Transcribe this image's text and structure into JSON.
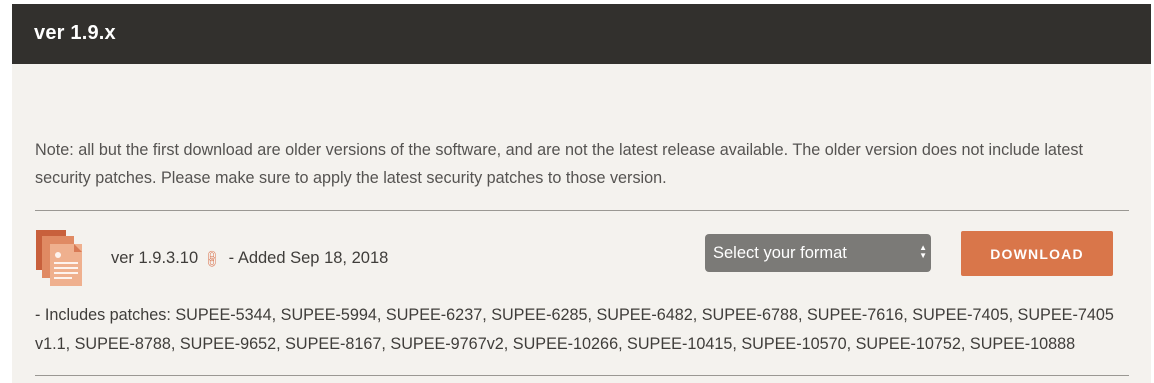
{
  "header": {
    "title": "ver 1.9.x"
  },
  "note": {
    "text": "Note: all but the first download are older versions of the software, and are not the latest release available. The older version does not include latest security patches. Please make sure to apply the latest security patches to those version."
  },
  "release": {
    "version": "ver 1.9.3.10",
    "added": "- Added Sep 18, 2018",
    "icon": "document-stack-icon",
    "link_icon": "link-icon",
    "format_select": {
      "selected": "Select your format"
    },
    "download_label": "DOWNLOAD",
    "patches": "- Includes patches: SUPEE-5344, SUPEE-5994, SUPEE-6237, SUPEE-6285, SUPEE-6482, SUPEE-6788, SUPEE-7616, SUPEE-7405, SUPEE-7405 v1.1, SUPEE-8788, SUPEE-9652, SUPEE-8167, SUPEE-9767v2, SUPEE-10266, SUPEE-10415, SUPEE-10570, SUPEE-10752, SUPEE-10888"
  },
  "colors": {
    "header_bg": "#32302d",
    "panel_bg": "#f4f2ee",
    "accent": "#d9764a",
    "select_bg": "#7b7a77"
  }
}
